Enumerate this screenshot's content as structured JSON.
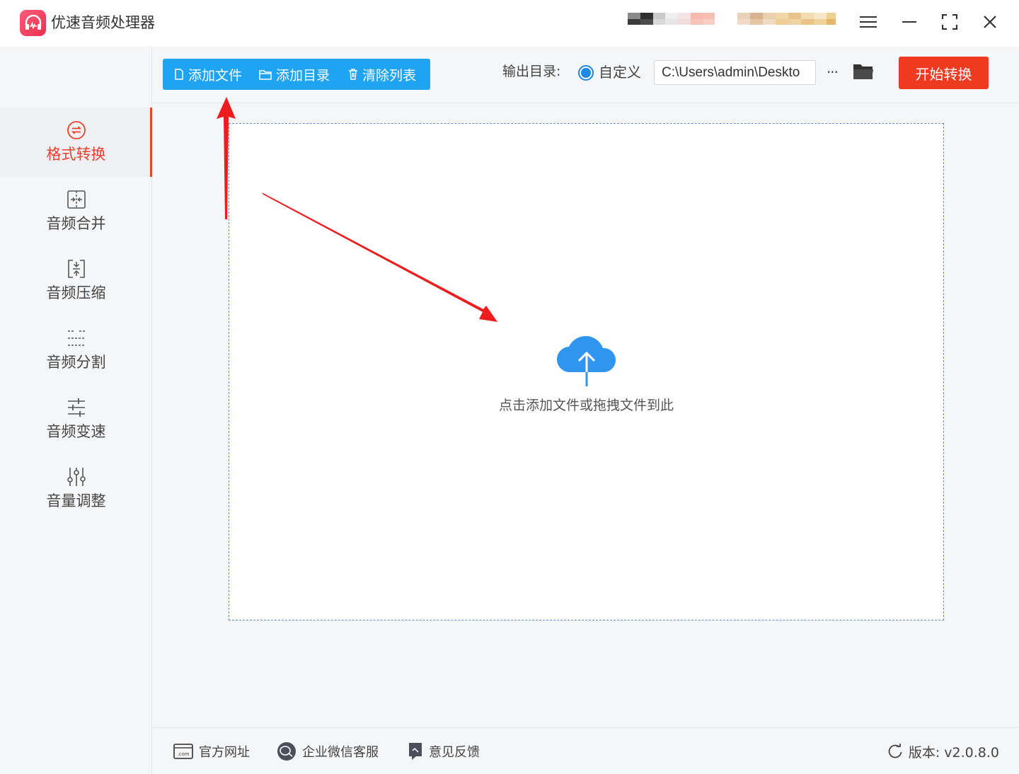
{
  "app": {
    "title": "优速音频处理器"
  },
  "sidebar": {
    "items": [
      {
        "label": "格式转换",
        "icon": "format-convert-icon",
        "active": true
      },
      {
        "label": "音频合并",
        "icon": "merge-icon",
        "active": false
      },
      {
        "label": "音频压缩",
        "icon": "compress-icon",
        "active": false
      },
      {
        "label": "音频分割",
        "icon": "split-icon",
        "active": false
      },
      {
        "label": "音频变速",
        "icon": "speed-icon",
        "active": false
      },
      {
        "label": "音量调整",
        "icon": "volume-icon",
        "active": false
      }
    ]
  },
  "toolbar": {
    "add_file": "添加文件",
    "add_folder": "添加目录",
    "clear_list": "清除列表"
  },
  "output": {
    "label": "输出目录:",
    "option_label": "自定义",
    "path_value": "C:\\Users\\admin\\Deskto",
    "more": "···"
  },
  "start_button": "开始转换",
  "dropzone": {
    "hint": "点击添加文件或拖拽文件到此"
  },
  "footer": {
    "website": "官方网址",
    "wechat_support": "企业微信客服",
    "feedback": "意见反馈",
    "version": "版本: v2.0.8.0"
  },
  "colors": {
    "accent": "#1ea4f2",
    "start_button": "#ee3b1f",
    "active_nav": "#e8422e",
    "annotation_arrow": "#ee1c1c"
  }
}
